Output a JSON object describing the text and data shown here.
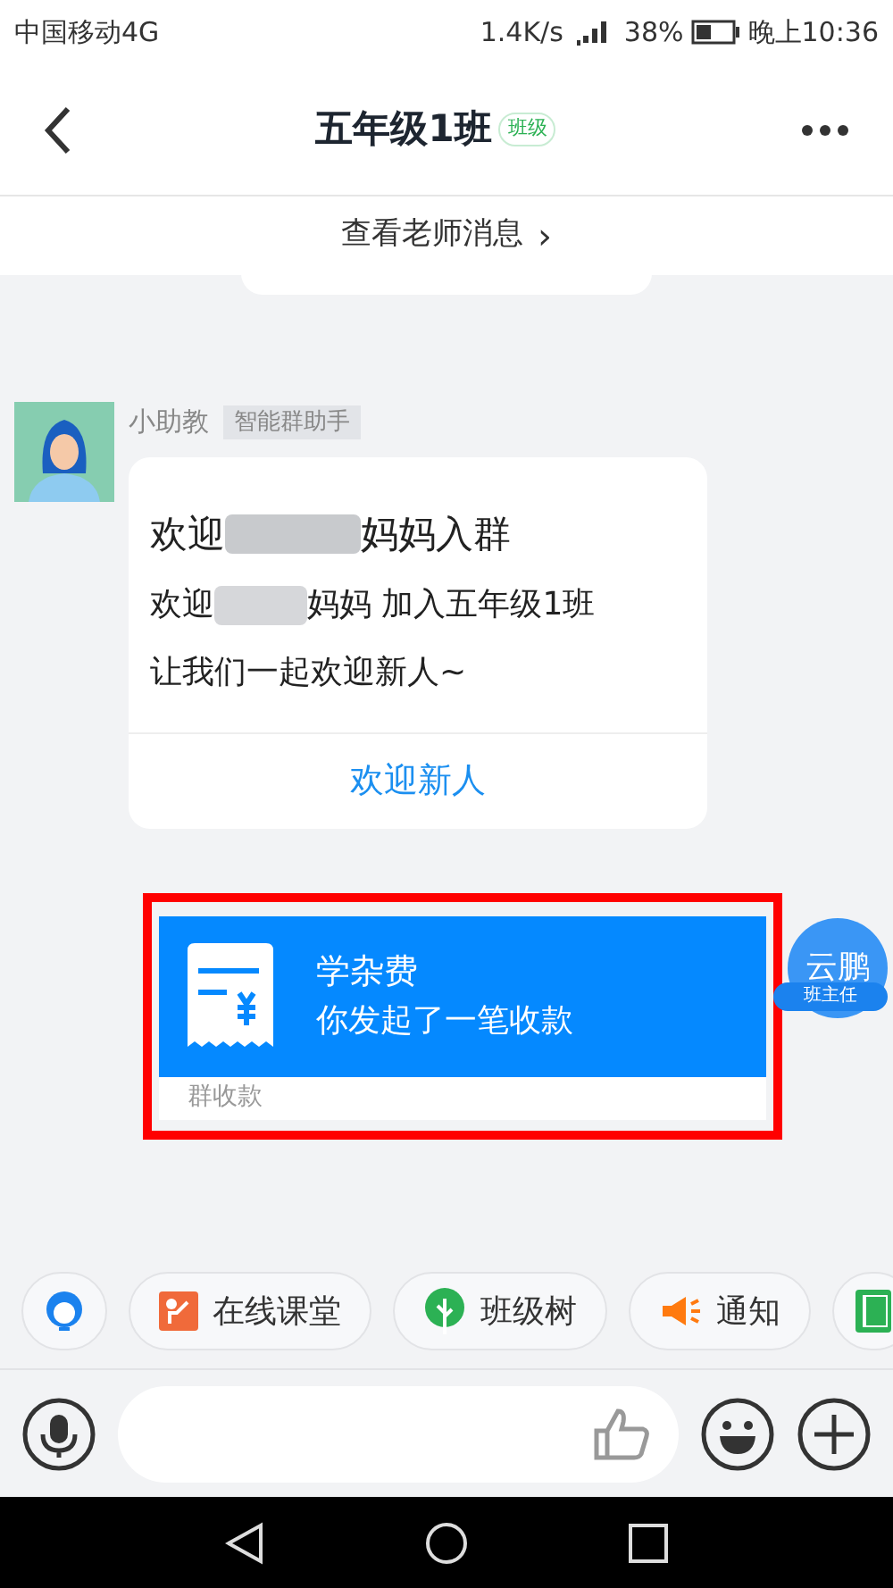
{
  "status_bar": {
    "carrier": "中国移动4G",
    "speed": "1.4K/s",
    "battery": "38%",
    "time": "晚上10:36"
  },
  "header": {
    "title": "五年级1班",
    "badge": "班级"
  },
  "teacher_bar": {
    "label": "查看老师消息",
    "arrow": "›"
  },
  "messages": [
    {
      "kind": "welcome",
      "sender": "小助教",
      "tag": "智能群助手",
      "line1_start": "欢迎",
      "line1_end": "妈妈入群",
      "line2_start": "欢迎",
      "line2_end": "妈妈 加入五年级1班",
      "line3": "让我们一起欢迎新人~",
      "action": "欢迎新人"
    },
    {
      "kind": "payment",
      "title": "学杂费",
      "subtitle": "你发起了一笔收款",
      "footer": "群收款",
      "avatar_name": "云鹏",
      "role": "班主任",
      "highlighted": true
    }
  ],
  "toolbar": [
    {
      "kind": "service"
    },
    {
      "kind": "classroom",
      "label": "在线课堂"
    },
    {
      "kind": "tree",
      "label": "班级树"
    },
    {
      "kind": "notice",
      "label": "通知"
    },
    {
      "kind": "homework"
    }
  ]
}
